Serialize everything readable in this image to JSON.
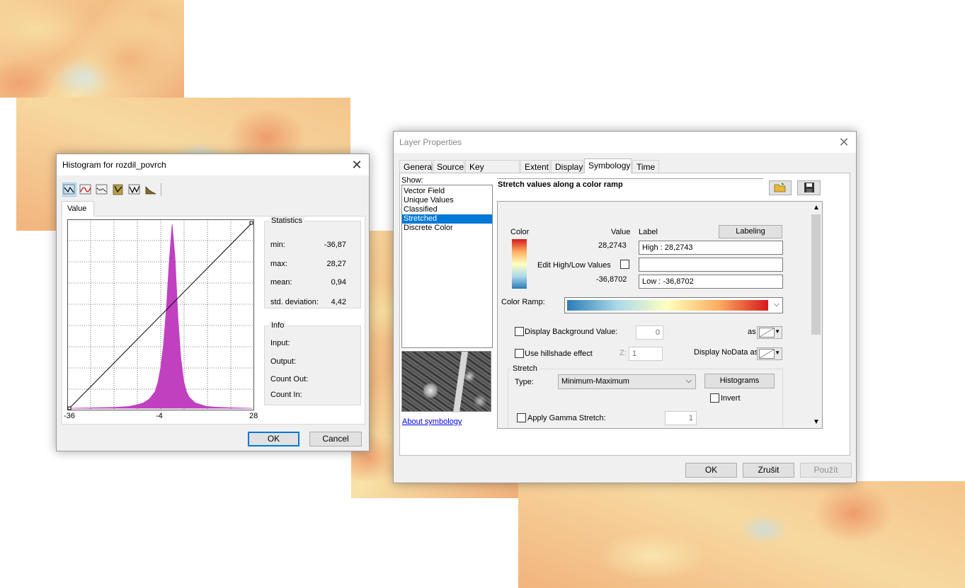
{
  "histogram": {
    "title": "Histogram for rozdil_povrch",
    "tab": "Value",
    "x_ticks": [
      "-36",
      "-4",
      "28"
    ],
    "statistics": {
      "title": "Statistics",
      "rows": [
        {
          "label": "min:",
          "value": "-36,87"
        },
        {
          "label": "max:",
          "value": "28,27"
        },
        {
          "label": "mean:",
          "value": "0,94"
        },
        {
          "label": "std. deviation:",
          "value": "4,42"
        }
      ]
    },
    "info": {
      "title": "Info",
      "rows": [
        "Input:",
        "Output:",
        "Count Out:",
        "Count In:"
      ]
    },
    "ok": "OK",
    "cancel": "Cancel",
    "bar_color": "#c040c0",
    "toolbar_icons": [
      "linear-tool-icon",
      "curve-tool-icon",
      "dotted-curve-tool-icon",
      "clip-tool-icon",
      "wave-tool-icon",
      "histogram-tool-icon"
    ]
  },
  "chart_data": {
    "type": "area",
    "title": "",
    "xlabel": "",
    "ylabel": "",
    "xlim": [
      -36,
      28
    ],
    "x_tick_labels": [
      "-36",
      "-4",
      "28"
    ],
    "grid": true,
    "series": [
      {
        "type": "area",
        "color": "#c040c0",
        "x": [
          -36,
          -20,
          -15,
          -12,
          -10,
          -8,
          -6,
          -5,
          -4,
          -3,
          -2,
          -1,
          0,
          1,
          2,
          3,
          4,
          5,
          6,
          8,
          10,
          12,
          15,
          20,
          28
        ],
        "y": [
          0.0,
          0.005,
          0.01,
          0.02,
          0.03,
          0.05,
          0.09,
          0.14,
          0.22,
          0.35,
          0.55,
          0.8,
          1.0,
          0.82,
          0.5,
          0.28,
          0.15,
          0.09,
          0.06,
          0.03,
          0.02,
          0.01,
          0.006,
          0.003,
          0.0
        ]
      },
      {
        "type": "line",
        "color": "#000000",
        "x": [
          -36,
          28
        ],
        "y": [
          0,
          1
        ]
      }
    ]
  },
  "layer": {
    "title": "Layer Properties",
    "tabs": [
      "General",
      "Source",
      "Key Metadata",
      "Extent",
      "Display",
      "Symbology",
      "Time"
    ],
    "active_tab": "Symbology",
    "show_label": "Show:",
    "show_items": [
      "Vector Field",
      "Unique Values",
      "Classified",
      "Stretched",
      "Discrete Color"
    ],
    "selected_item": "Stretched",
    "about_link": "About symbology",
    "header": "Stretch values along a color ramp",
    "color_col": "Color",
    "value_col": "Value",
    "label_col": "Label",
    "labeling_btn": "Labeling",
    "high_value": "28,2743",
    "high_label": "High : 28,2743",
    "edit_hl": "Edit High/Low Values",
    "mid_label": "",
    "low_value": "-36,8702",
    "low_label": "Low : -36,8702",
    "color_ramp_label": "Color Ramp:",
    "bg_value_label": "Display Background Value:",
    "bg_value": "0",
    "as_label": "as",
    "hillshade_label": "Use hillshade effect",
    "z_label": "Z:",
    "z_value": "1",
    "nodata_label": "Display NoData as",
    "stretch_title": "Stretch",
    "type_label": "Type:",
    "type_value": "Minimum-Maximum",
    "histograms_btn": "Histograms",
    "invert_label": "Invert",
    "gamma_label": "Apply Gamma Stretch:",
    "gamma_value": "1",
    "ok": "OK",
    "cancel": "Zrušit",
    "apply": "Použít",
    "ramp_colors": [
      "#2c7bb6",
      "#abd9e9",
      "#ffffbf",
      "#fdae61",
      "#d7191c"
    ]
  }
}
